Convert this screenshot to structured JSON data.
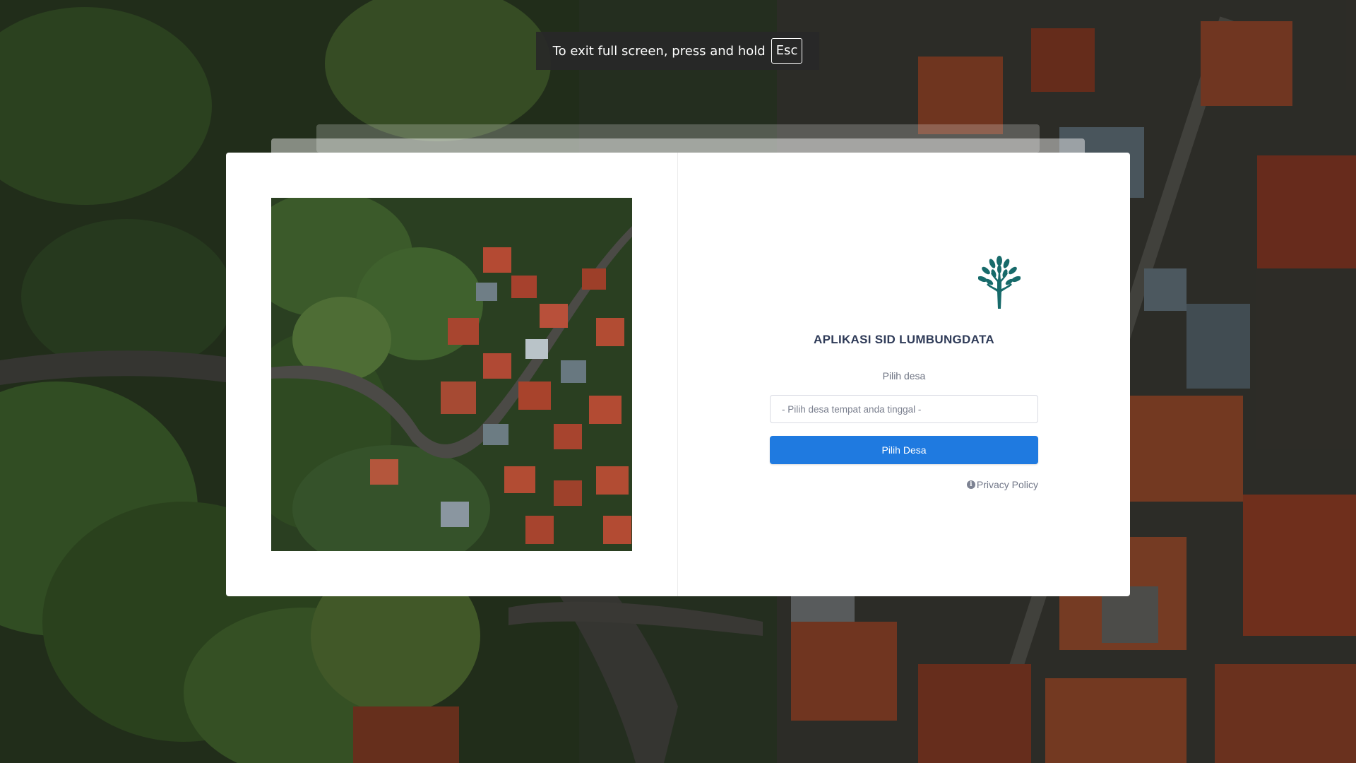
{
  "fullscreen_notice": {
    "message": "To exit full screen, press and hold",
    "key": "Esc"
  },
  "app": {
    "title": "APLIKASI SID LUMBUNGDATA",
    "logo_icon": "tree-icon",
    "logo_color": "#176a6a"
  },
  "form": {
    "select_label": "Pilih desa",
    "select_placeholder": "- Pilih desa tempat anda tinggal -",
    "submit_label": "Pilih Desa",
    "accent_color": "#1f7ae0"
  },
  "footer": {
    "privacy_label": "Privacy Policy",
    "privacy_icon": "info-icon"
  }
}
